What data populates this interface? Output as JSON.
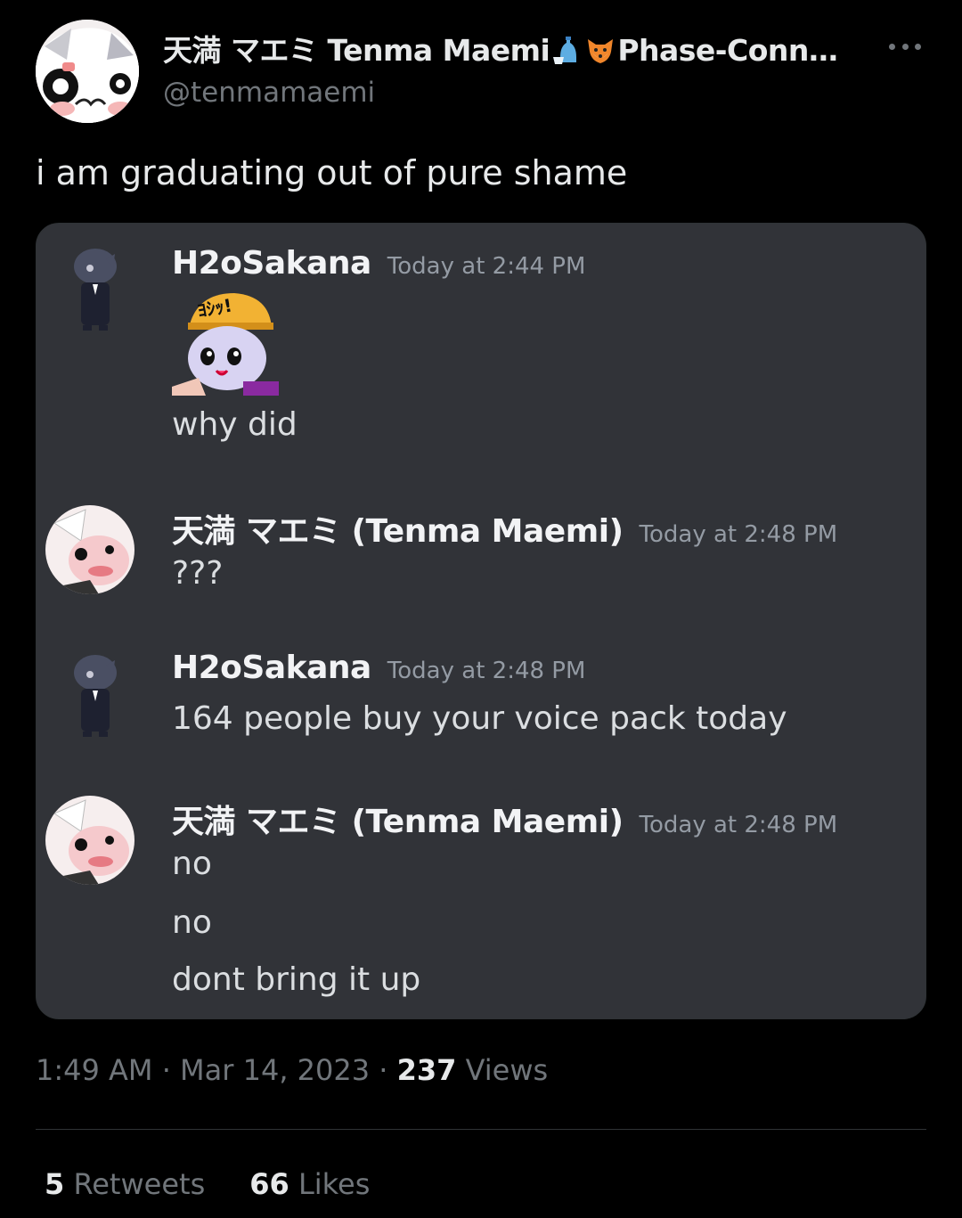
{
  "tweet": {
    "display_name": "天満 マエミ Tenma Maemi",
    "display_name_suffix": "Phase-Conn…",
    "name_emojis": [
      "sake-icon",
      "fox-icon"
    ],
    "handle": "@tenmamaemi",
    "text": "i am graduating out of pure shame",
    "time": "1:49 AM",
    "date": "Mar 14, 2023",
    "views_count": "237",
    "views_label": "Views",
    "retweets_count": "5",
    "retweets_label": "Retweets",
    "likes_count": "66",
    "likes_label": "Likes"
  },
  "chat": {
    "messages": [
      {
        "user": "H2oSakana",
        "time": "Today at 2:44 PM",
        "lines": [
          "why did"
        ],
        "has_sticker": true,
        "sticker_text": "ﾖｼｯ!"
      },
      {
        "user": "天満 マエミ (Tenma Maemi)",
        "time": "Today at 2:48 PM",
        "lines": [
          "???"
        ]
      },
      {
        "user": "H2oSakana",
        "time": "Today at 2:48 PM",
        "lines": [
          "164 people buy your voice pack today"
        ]
      },
      {
        "user": "天満 マエミ (Tenma Maemi)",
        "time": "Today at 2:48 PM",
        "lines": [
          "no",
          "no",
          "dont bring it up"
        ]
      }
    ]
  },
  "colors": {
    "background": "#000000",
    "primary_text": "#e7e9ea",
    "secondary_text": "#71767b",
    "discord_bg": "#313338",
    "discord_timestamp": "#949ba4",
    "discord_message": "#dbdee1"
  }
}
